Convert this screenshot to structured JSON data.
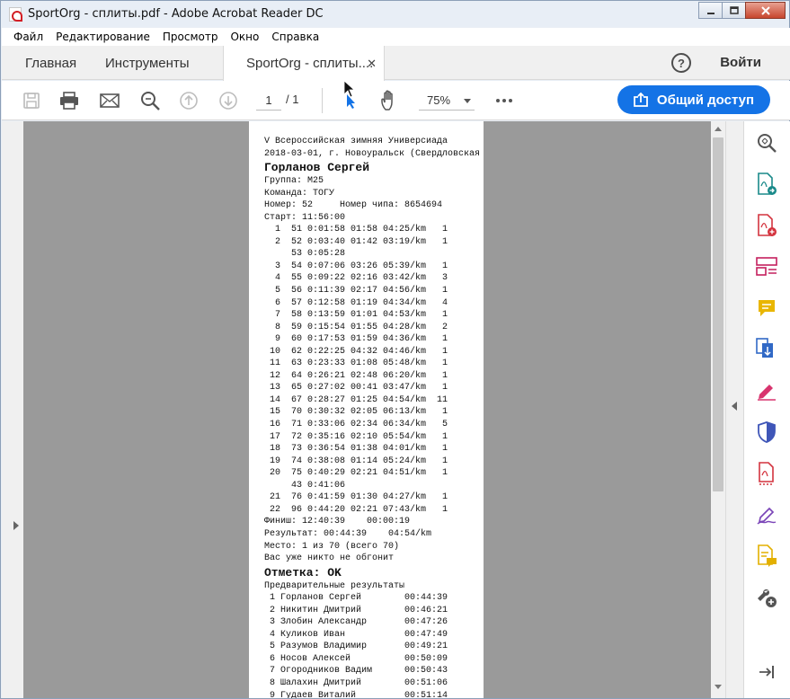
{
  "window": {
    "title": "SportOrg - сплиты.pdf - Adobe Acrobat Reader DC",
    "buttons": {
      "minimize": "_",
      "maximize": "□",
      "close": "✕"
    }
  },
  "menu": [
    "Файл",
    "Редактирование",
    "Просмотр",
    "Окно",
    "Справка"
  ],
  "tabs": {
    "home": "Главная",
    "tools": "Инструменты",
    "doc": "SportOrg - сплиты....",
    "doc_close": "✕"
  },
  "header": {
    "help": "?",
    "signin": "Войти"
  },
  "toolbar": {
    "page_current": "1",
    "page_total": "/ 1",
    "zoom": "75%",
    "share_label": "Общий доступ",
    "icons": [
      "save-icon",
      "print-icon",
      "email-icon",
      "search-icon",
      "page-up-icon",
      "page-down-icon",
      "select-cursor-icon",
      "hand-icon",
      "more-icon"
    ]
  },
  "document": {
    "lines": [
      "V Всероссийская зимняя Универсиада",
      "2018-03-01, г. Новоуральск (Свердловская",
      {
        "big": "Горланов Сергей"
      },
      "Группа: M25",
      "Команда: ТОГУ",
      "Номер: 52     Номер чипа: 8654694",
      "Старт: 11:56:00",
      "  1  51 0:01:58 01:58 04:25/km   1",
      "  2  52 0:03:40 01:42 03:19/km   1",
      "     53 0:05:28",
      "  3  54 0:07:06 03:26 05:39/km   1",
      "  4  55 0:09:22 02:16 03:42/km   3",
      "  5  56 0:11:39 02:17 04:56/km   1",
      "  6  57 0:12:58 01:19 04:34/km   4",
      "  7  58 0:13:59 01:01 04:53/km   1",
      "  8  59 0:15:54 01:55 04:28/km   2",
      "  9  60 0:17:53 01:59 04:36/km   1",
      " 10  62 0:22:25 04:32 04:46/km   1",
      " 11  63 0:23:33 01:08 05:48/km   1",
      " 12  64 0:26:21 02:48 06:20/km   1",
      " 13  65 0:27:02 00:41 03:47/km   1",
      " 14  67 0:28:27 01:25 04:54/km  11",
      " 15  70 0:30:32 02:05 06:13/km   1",
      " 16  71 0:33:06 02:34 06:34/km   5",
      " 17  72 0:35:16 02:10 05:54/km   1",
      " 18  73 0:36:54 01:38 04:01/km   1",
      " 19  74 0:38:08 01:14 05:24/km   1",
      " 20  75 0:40:29 02:21 04:51/km   1",
      "     43 0:41:06",
      " 21  76 0:41:59 01:30 04:27/km   1",
      " 22  96 0:44:20 02:21 07:43/km   1",
      "Финиш: 12:40:39    00:00:19",
      "Результат: 00:44:39    04:54/km",
      "Место: 1 из 70 (всего 70)",
      "Вас уже никто не обгонит",
      {
        "big": "Отметка: OK"
      },
      "Предварительные результаты",
      " 1 Горланов Сергей        00:44:39",
      " 2 Никитин Дмитрий        00:46:21",
      " 3 Злобин Александр       00:47:26",
      " 4 Куликов Иван           00:47:49",
      " 5 Разумов Владимир       00:49:21",
      " 6 Носов Алексей          00:50:09",
      " 7 Огородников Вадим      00:50:43",
      " 8 Шалахин Дмитрий        00:51:06",
      " 9 Гудаев Виталий         00:51:14"
    ]
  },
  "right_panel": [
    "zoom-fit-icon",
    "export-pdf-icon",
    "create-pdf-icon",
    "organize-pages-icon",
    "comment-icon",
    "combine-files-icon",
    "fill-sign-icon",
    "protect-icon",
    "pdf-optimize-icon",
    "sign-icon",
    "send-review-icon",
    "more-tools-icon",
    "collapse-panel-icon"
  ]
}
